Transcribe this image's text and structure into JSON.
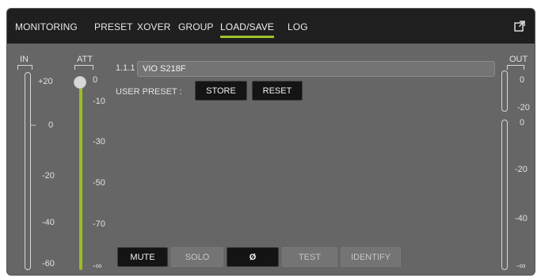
{
  "tabs": [
    {
      "label": "MONITORING"
    },
    {
      "label": "PRESET"
    },
    {
      "label": "XOVER"
    },
    {
      "label": "GROUP"
    },
    {
      "label": "LOAD/SAVE",
      "active": true
    },
    {
      "label": "LOG"
    }
  ],
  "icons": {
    "expand": "expand-arrows-icon"
  },
  "colors": {
    "accent": "#9ec42a",
    "topbar": "#1f1f1f",
    "panel": "#666666"
  },
  "in_meter": {
    "label": "IN",
    "ticks": [
      "+20",
      "0",
      "-20",
      "-40",
      "-60"
    ]
  },
  "att": {
    "label": "ATT",
    "ticks": [
      "0",
      "-10",
      "-30",
      "-50",
      "-70",
      "-∞"
    ],
    "level": 0
  },
  "channel": {
    "id": "1.1.1",
    "name": "VIO S218F"
  },
  "user_preset": {
    "label": "USER PRESET :",
    "store": "STORE",
    "reset": "RESET"
  },
  "out_meter": {
    "label": "OUT",
    "top_ticks": [
      "0",
      "-20"
    ],
    "ticks": [
      "0",
      "-20",
      "-40",
      "-∞"
    ]
  },
  "bottom_buttons": {
    "mute": "MUTE",
    "solo": "SOLO",
    "phase": "Ø",
    "test": "TEST",
    "identify": "IDENTIFY"
  }
}
